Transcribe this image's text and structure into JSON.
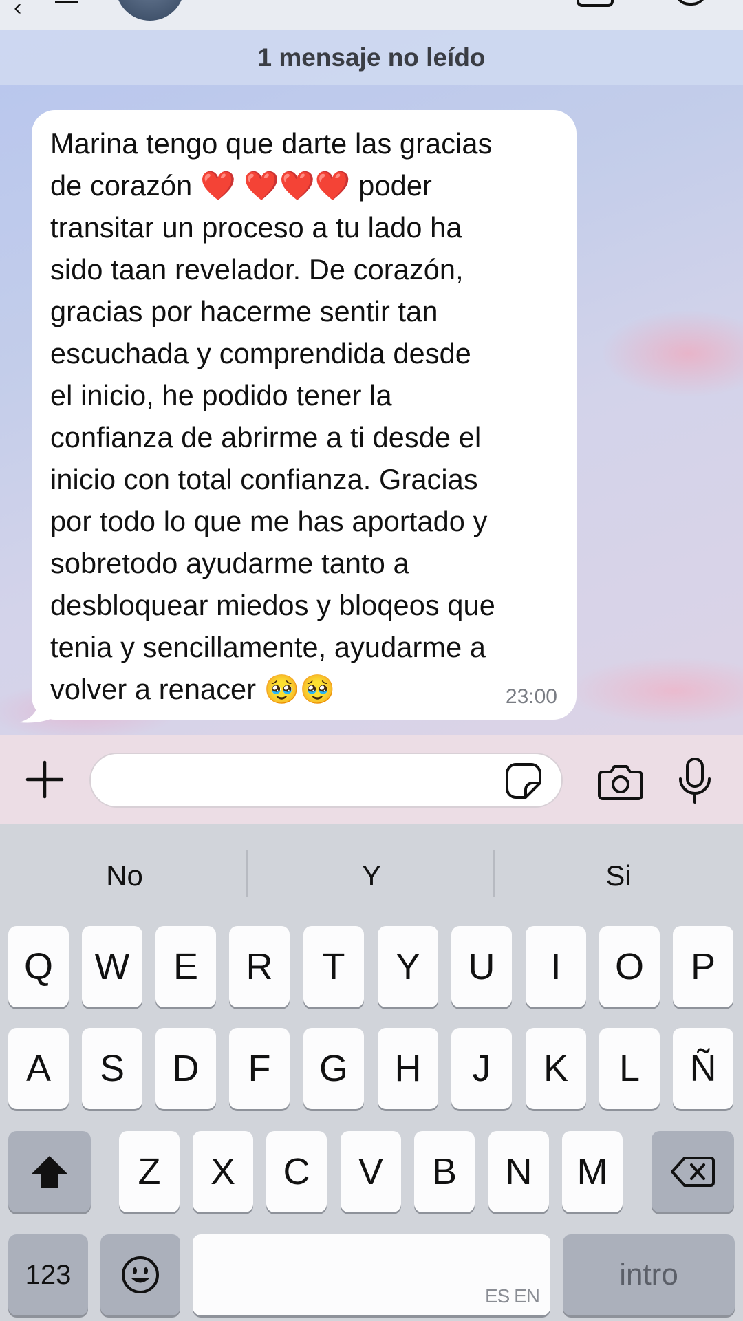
{
  "unread_banner": "1 mensaje no leído",
  "message": {
    "text": "Marina tengo que darte las gracias\nde corazón ❤️ ❤️❤️❤️ poder\ntransitar un proceso a tu lado ha\nsido taan revelador. De corazón,\ngracias por hacerme sentir tan\nescuchada y comprendida desde\nel inicio, he podido tener la\nconfianza de abrirme a ti desde el\ninicio con total confianza. Gracias\npor todo lo que me has aportado y\nsobretodo ayudarme tanto a\ndesbloquear miedos y bloqeos que\ntenia y sencillamente, ayudarme a\nvolver a renacer 🥹🥹",
    "time": "23:00"
  },
  "input": {
    "value": "",
    "plus_icon": "plus-icon",
    "sticker_icon": "sticker-icon",
    "camera_icon": "camera-icon",
    "mic_icon": "microphone-icon"
  },
  "keyboard": {
    "suggestions": [
      "No",
      "Y",
      "Si"
    ],
    "row1": [
      "Q",
      "W",
      "E",
      "R",
      "T",
      "Y",
      "U",
      "I",
      "O",
      "P"
    ],
    "row2": [
      "A",
      "S",
      "D",
      "F",
      "G",
      "H",
      "J",
      "K",
      "L",
      "Ñ"
    ],
    "row3": [
      "Z",
      "X",
      "C",
      "V",
      "B",
      "N",
      "M"
    ],
    "numbers_key": "123",
    "return_key": "intro",
    "space_languages": "ES EN",
    "shift_icon": "shift-icon",
    "delete_icon": "delete-icon",
    "emoji_icon": "emoji-icon"
  },
  "colors": {
    "bubble": "#ffffff",
    "input_bar": "#ecdde5",
    "keyboard": "#d1d4da",
    "key": "#fcfcfd",
    "dark_key": "#abb0bb"
  }
}
